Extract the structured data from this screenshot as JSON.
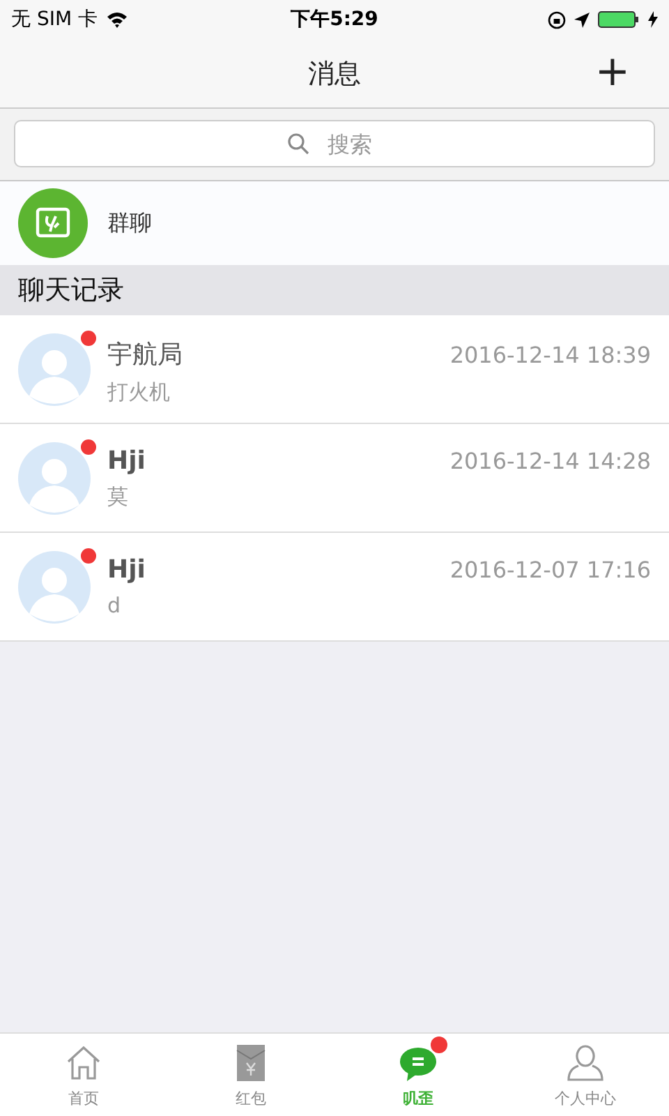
{
  "status_bar": {
    "carrier": "无 SIM 卡",
    "time": "下午5:29",
    "battery_charging": true
  },
  "nav": {
    "title": "消息",
    "action": "+"
  },
  "search": {
    "placeholder": "搜索"
  },
  "group_chat": {
    "label": "群聊"
  },
  "section": {
    "title": "聊天记录"
  },
  "chats": [
    {
      "name": "宇航局",
      "preview": "打火机",
      "time": "2016-12-14 18:39",
      "unread": true,
      "bold": false
    },
    {
      "name": "Hji",
      "preview": "莫",
      "time": "2016-12-14 14:28",
      "unread": true,
      "bold": true
    },
    {
      "name": "Hji",
      "preview": "d",
      "time": "2016-12-07 17:16",
      "unread": true,
      "bold": true
    }
  ],
  "tabs": [
    {
      "kind": "home",
      "label": "首页",
      "selected": false,
      "badge": false
    },
    {
      "kind": "envelope",
      "label": "红包",
      "selected": false,
      "badge": false
    },
    {
      "kind": "chat",
      "label": "叽歪",
      "selected": true,
      "badge": true
    },
    {
      "kind": "person",
      "label": "个人中心",
      "selected": false,
      "badge": false
    }
  ]
}
